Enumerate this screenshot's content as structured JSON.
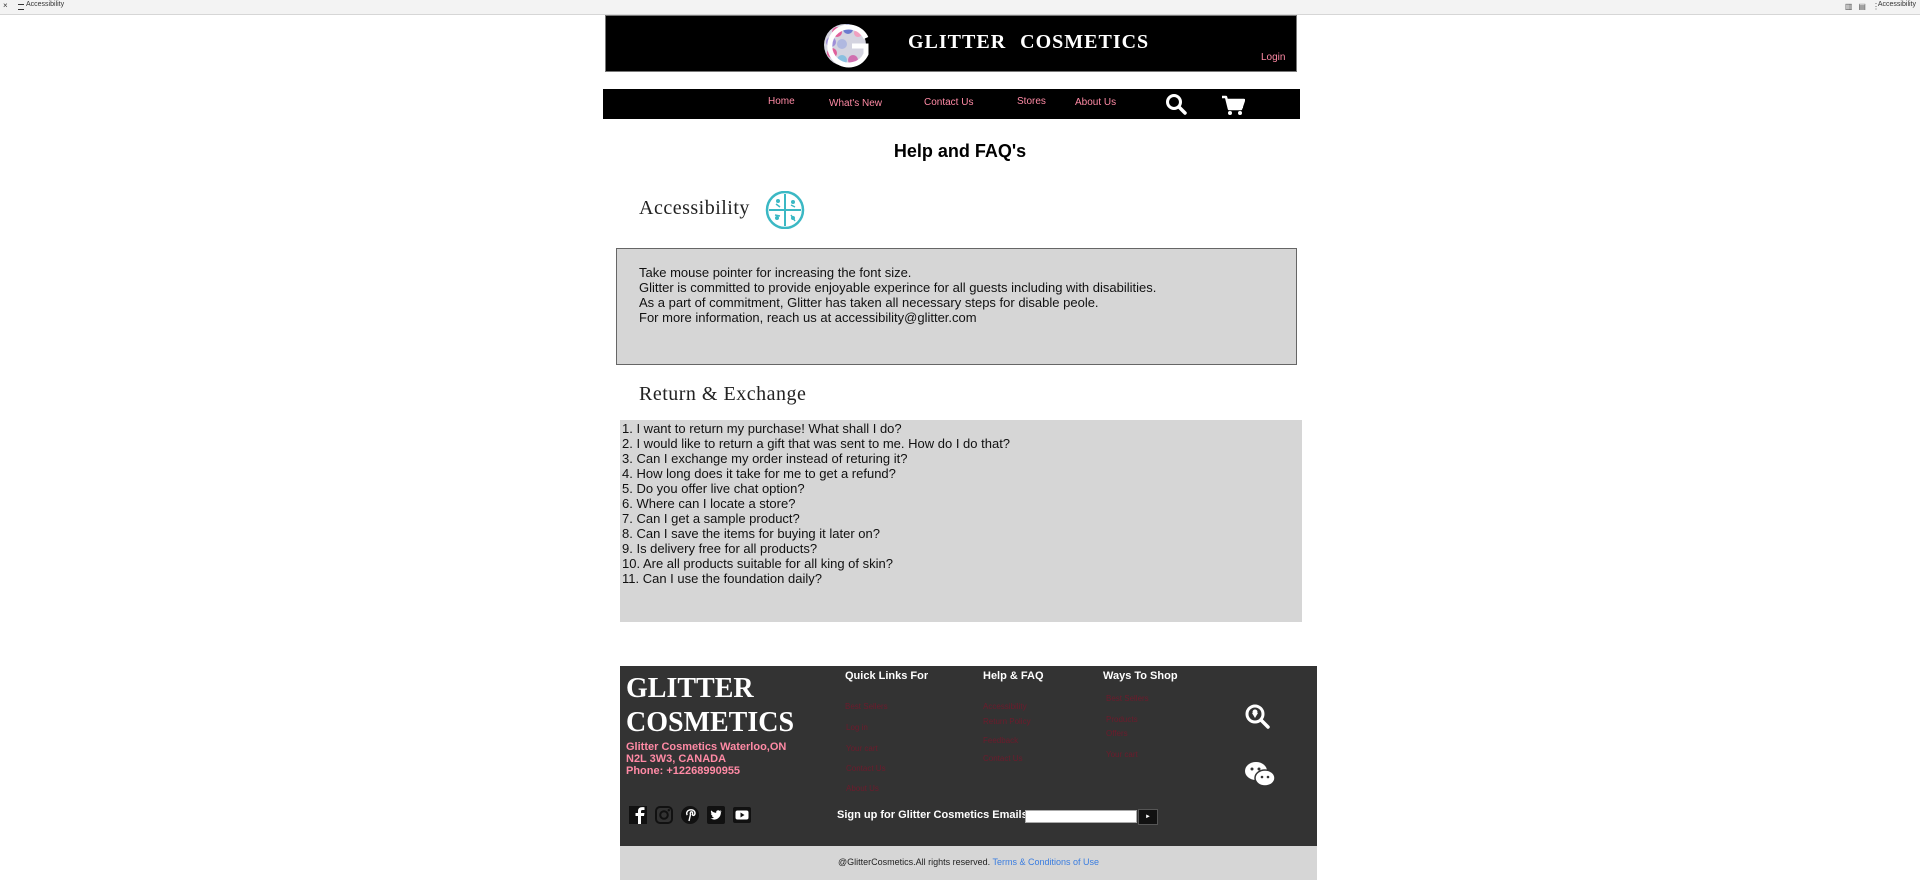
{
  "browser": {
    "tab_title": "Accessibility",
    "right_text": "Accessibility"
  },
  "header": {
    "brand": "GLITTER COSMETICS",
    "login": "Login"
  },
  "nav": {
    "items": [
      "Home",
      "What's New",
      "Contact Us",
      "Stores",
      "About Us"
    ]
  },
  "page_title": "Help and FAQ's",
  "accessibility": {
    "heading": "Accessibility",
    "lines": [
      "Take mouse pointer for increasing the font size.",
      "Glitter is committed to provide enjoyable experince for all guests including with disabilities.",
      "As a part of commitment, Glitter has taken all necessary steps for disable peole.",
      "For more information, reach us at accessibility@glitter.com"
    ]
  },
  "returns": {
    "heading": "Return & Exchange",
    "questions": [
      "1. I want to return my purchase! What shall I do?",
      "2. I would like to return a gift that was sent to me. How do I do that?",
      "3. Can I exchange my order instead of returing it?",
      "4. How long does it take for me to get a refund?",
      "5. Do you offer live chat option?",
      "6. Where can I locate a store?",
      "7. Can I get a sample product?",
      "8. Can I save the items for buying it later on?",
      "9. Is delivery free for all products?",
      "10. Are all products suitable for all king of skin?",
      "11. Can I use the foundation daily?"
    ]
  },
  "footer": {
    "brand_line1": "GLITTER",
    "brand_line2": "COSMETICS",
    "address_line1": "Glitter Cosmetics Waterloo,ON",
    "address_line2": "N2L 3W3, CANADA",
    "phone": "Phone: +12268990955",
    "quick_links_title": "Quick Links For",
    "quick_links": [
      "Best Sellers",
      "Log in",
      "Your cart",
      "Contact Us",
      "About Us"
    ],
    "help_title": "Help & FAQ",
    "help_links": [
      "Accessibility",
      "Return Policy",
      "Feedback",
      "Contact Us"
    ],
    "shop_title": "Ways To Shop",
    "shop_links": [
      "Best Sellers",
      "Products",
      "Offers",
      "Your cart"
    ],
    "signup_label": "Sign up for Glitter Cosmetics Emails",
    "submit_label": "►"
  },
  "copyright": {
    "text": "@GlitterCosmetics.All rights reserved.",
    "terms": "Terms & Conditions of Use"
  },
  "colors": {
    "nav_link": "#ff8aa5",
    "footer_bg": "#333333",
    "content_box": "#d6d6d6",
    "terms_link": "#3a7de0"
  },
  "icons": [
    "search-icon",
    "cart-icon",
    "accessibility-icon",
    "facebook-icon",
    "instagram-icon",
    "pinterest-icon",
    "twitter-icon",
    "youtube-icon",
    "location-search-icon",
    "wechat-icon"
  ]
}
